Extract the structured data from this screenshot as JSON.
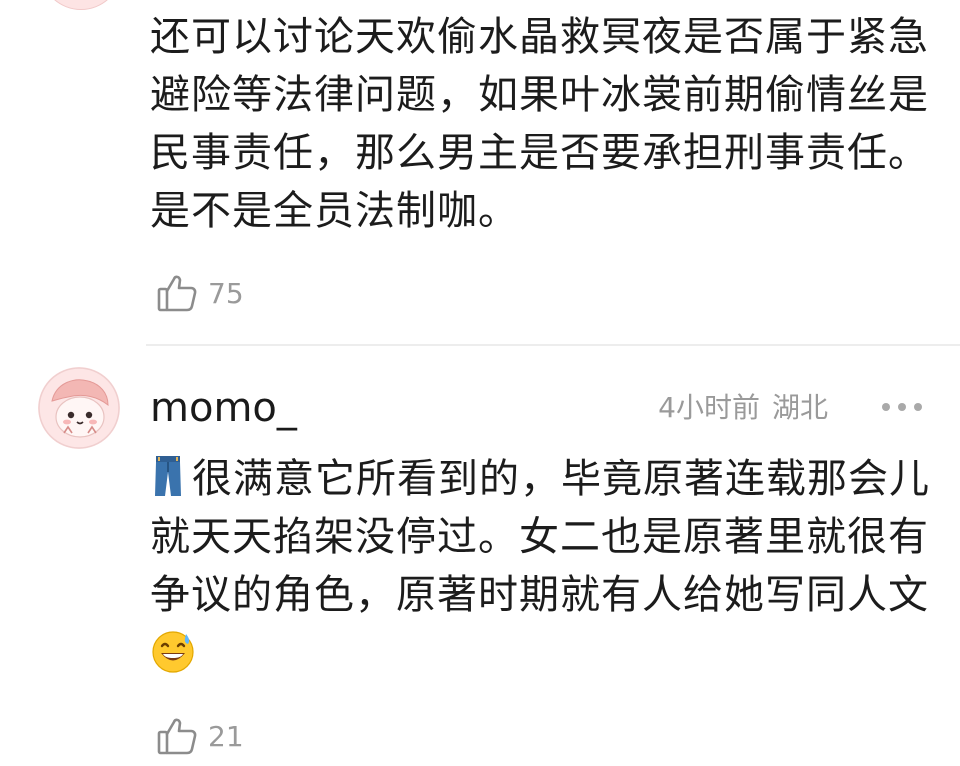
{
  "comments": [
    {
      "lines": [
        "还可以讨论天欢偷水晶救冥夜是否属于紧急",
        "避险等法律问题，如果叶冰裳前期偷情丝是",
        "民事责任，那么男主是否要承担刑事责任。",
        "是不是全员法制咖。"
      ],
      "likes": "75"
    },
    {
      "username": "momo_",
      "time": "4小时前",
      "location": "湖北",
      "lines": [
        "很满意它所看到的，毕竟原著连载那会儿",
        "就天天掐架没停过。女二也是原著里就很有",
        "争议的角色，原著时期就有人给她写同人文"
      ],
      "leading_emoji": "jeans-icon",
      "trailing_emoji": "grinning-sweat-icon",
      "likes": "21"
    }
  ],
  "colors": {
    "text": "#1c1c1c",
    "meta": "#9a9a9a",
    "divider": "#ededed",
    "avatar_bg": "#fde4e4"
  }
}
